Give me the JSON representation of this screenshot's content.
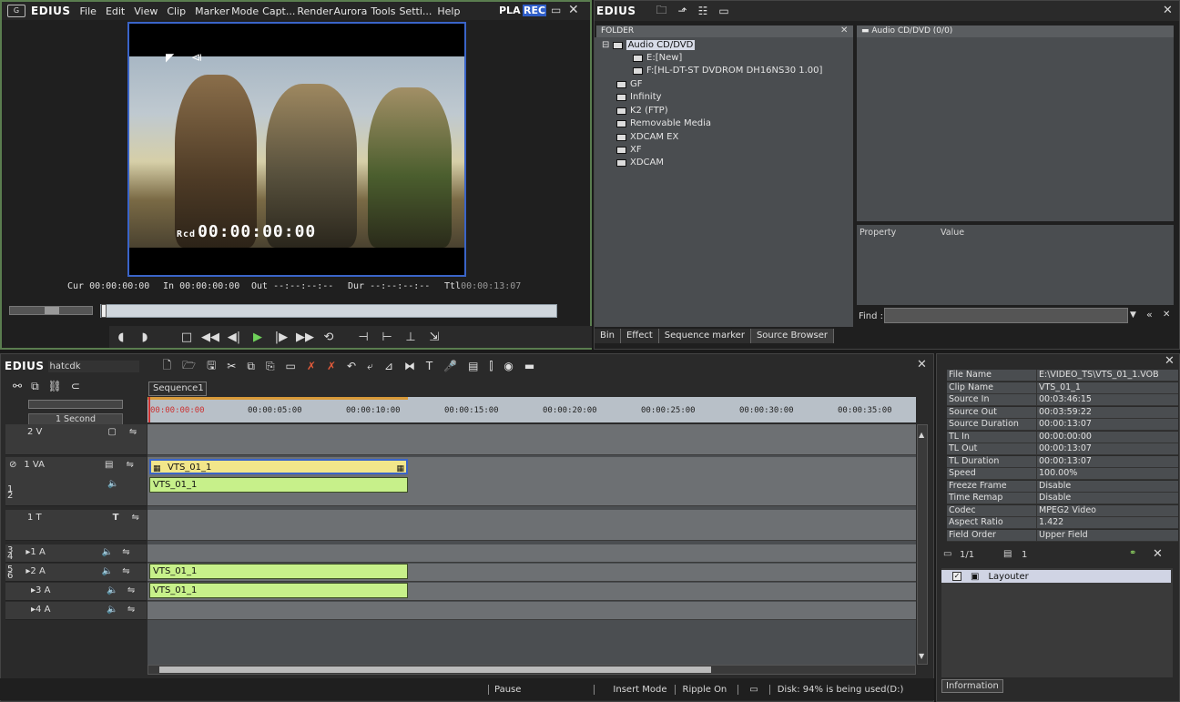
{
  "player": {
    "logo": "G",
    "brand": "EDIUS",
    "menu": [
      "File",
      "Edit",
      "View",
      "Clip",
      "Marker",
      "Mode",
      "Capt...",
      "Render",
      "Aurora",
      "Tools",
      "Setti...",
      "Help"
    ],
    "pla_label": "PLA",
    "rec_label": "REC",
    "rec_prefix": "Rcd",
    "timecode": "00:00:00:00",
    "cur_label": "Cur",
    "cur_value": "00:00:00:00",
    "in_label": "In",
    "in_value": "00:00:00:00",
    "out_label": "Out",
    "out_value": "--:--:--:--",
    "dur_label": "Dur",
    "dur_value": "--:--:--:--",
    "ttl_label": "Ttl",
    "ttl_value": "00:00:13:07"
  },
  "bin": {
    "brand": "EDIUS",
    "folder_header": "FOLDER",
    "content_header": "Audio CD/DVD (0/0)",
    "tree": [
      {
        "label": "Audio CD/DVD",
        "level": 0,
        "selected": true
      },
      {
        "label": "E:[New]",
        "level": 1
      },
      {
        "label": "F:[HL-DT-ST DVDROM DH16NS30 1.00]",
        "level": 1
      },
      {
        "label": "GF",
        "level": 0
      },
      {
        "label": "Infinity",
        "level": 0
      },
      {
        "label": "K2 (FTP)",
        "level": 0
      },
      {
        "label": "Removable Media",
        "level": 0
      },
      {
        "label": "XDCAM EX",
        "level": 0
      },
      {
        "label": "XF",
        "level": 0
      },
      {
        "label": "XDCAM",
        "level": 0
      }
    ],
    "property_label": "Property",
    "value_label": "Value",
    "find_label": "Find :",
    "tabs": [
      "Bin",
      "Effect",
      "Sequence marker",
      "Source Browser"
    ],
    "active_tab": "Source Browser"
  },
  "timeline": {
    "brand": "EDIUS",
    "project_name": "hatcdk",
    "sequence_tab": "Sequence1",
    "scale_label": "1 Second",
    "ruler": [
      "00:00:00:00",
      "00:00:05:00",
      "00:00:10:00",
      "00:00:15:00",
      "00:00:20:00",
      "00:00:25:00",
      "00:00:30:00",
      "00:00:35:00"
    ],
    "tracks": [
      {
        "id": "2V",
        "label": "2 V"
      },
      {
        "id": "1VA",
        "label": "1 VA"
      },
      {
        "id": "1T",
        "label": "1 T"
      },
      {
        "id": "1A",
        "label": "1 A"
      },
      {
        "id": "2A",
        "label": "2 A"
      },
      {
        "id": "3A",
        "label": "3 A"
      },
      {
        "id": "4A",
        "label": "4 A"
      }
    ],
    "channel_badges": [
      "1",
      "2",
      "3",
      "4",
      "5",
      "6"
    ],
    "clips": {
      "va_video": "VTS_01_1",
      "va_audio": "VTS_01_1",
      "a2": "VTS_01_1",
      "a3": "VTS_01_1"
    },
    "status": [
      "Pause",
      "Insert Mode",
      "Ripple On",
      "Disk: 94% is being used(D:)"
    ]
  },
  "info": {
    "rows": [
      {
        "k": "File Name",
        "v": "E:\\VIDEO_TS\\VTS_01_1.VOB"
      },
      {
        "k": "Clip Name",
        "v": "VTS_01_1"
      },
      {
        "k": "Source In",
        "v": "00:03:46:15"
      },
      {
        "k": "Source Out",
        "v": "00:03:59:22"
      },
      {
        "k": "Source Duration",
        "v": "00:00:13:07"
      },
      {
        "k": "TL In",
        "v": "00:00:00:00"
      },
      {
        "k": "TL Out",
        "v": "00:00:13:07"
      },
      {
        "k": "TL Duration",
        "v": "00:00:13:07"
      },
      {
        "k": "Speed",
        "v": "100.00%"
      },
      {
        "k": "Freeze Frame",
        "v": "Disable"
      },
      {
        "k": "Time Remap",
        "v": "Disable"
      },
      {
        "k": "Codec",
        "v": "MPEG2 Video"
      },
      {
        "k": "Aspect Ratio",
        "v": "1.422"
      },
      {
        "k": "Field Order",
        "v": "Upper Field"
      }
    ],
    "layer_count": "1/1",
    "filter_count": "1",
    "layouter_label": "Layouter",
    "tab_label": "Information"
  }
}
